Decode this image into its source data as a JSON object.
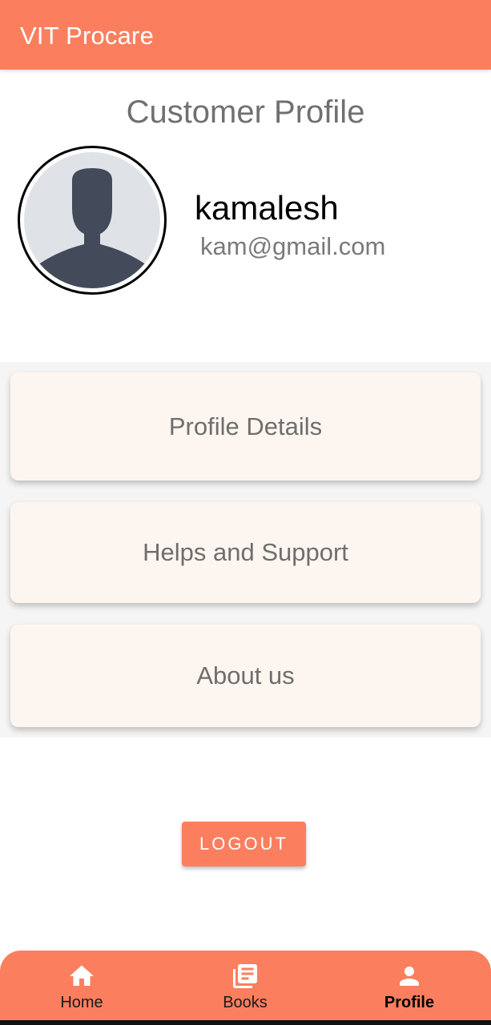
{
  "app_bar": {
    "title": "VIT Procare"
  },
  "page": {
    "title": "Customer Profile"
  },
  "profile": {
    "name": "kamalesh",
    "email": "kam@gmail.com",
    "avatar_icon": "person-silhouette-icon"
  },
  "menu": {
    "items": [
      {
        "label": "Profile Details"
      },
      {
        "label": "Helps and Support"
      },
      {
        "label": "About us"
      }
    ]
  },
  "actions": {
    "logout_label": "LOGOUT"
  },
  "bottom_nav": {
    "items": [
      {
        "label": "Home",
        "icon": "home-icon",
        "active": false
      },
      {
        "label": "Books",
        "icon": "library-books-icon",
        "active": false
      },
      {
        "label": "Profile",
        "icon": "person-icon",
        "active": true
      }
    ]
  },
  "colors": {
    "primary": "#fb7f5e",
    "card_background": "#fdf6f0",
    "avatar_silhouette": "#434a59",
    "avatar_background": "#dfe3e8"
  }
}
